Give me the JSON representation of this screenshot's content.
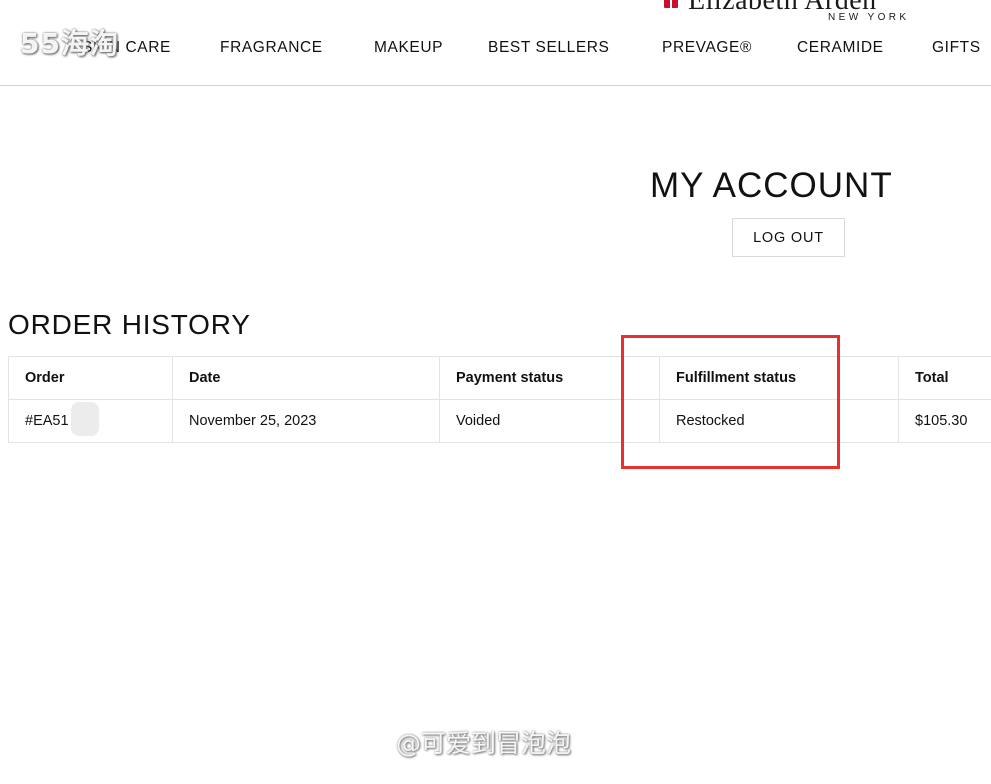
{
  "brand": {
    "name": "Elizabeth Arden",
    "subtitle": "NEW YORK",
    "logo_color": "#c8102e"
  },
  "nav": {
    "items": [
      {
        "label": "SKIN CARE"
      },
      {
        "label": "FRAGRANCE"
      },
      {
        "label": "MAKEUP"
      },
      {
        "label": "BEST SELLERS"
      },
      {
        "label": "PREVAGE®"
      },
      {
        "label": "CERAMIDE"
      },
      {
        "label": "GIFTS"
      }
    ]
  },
  "watermarks": {
    "top": "55海淘",
    "bottom": "@可爱到冒泡泡"
  },
  "account": {
    "title": "MY ACCOUNT",
    "logout_label": "LOG OUT"
  },
  "order_history": {
    "title": "ORDER HISTORY",
    "columns": [
      "Order",
      "Date",
      "Payment status",
      "Fulfillment status",
      "Total"
    ],
    "rows": [
      {
        "order": "#EA51",
        "date": "November 25, 2023",
        "payment_status": "Voided",
        "fulfillment_status": "Restocked",
        "total": "$105.30"
      }
    ]
  },
  "highlight": {
    "color": "#e8312f",
    "target_column": "Fulfillment status"
  }
}
